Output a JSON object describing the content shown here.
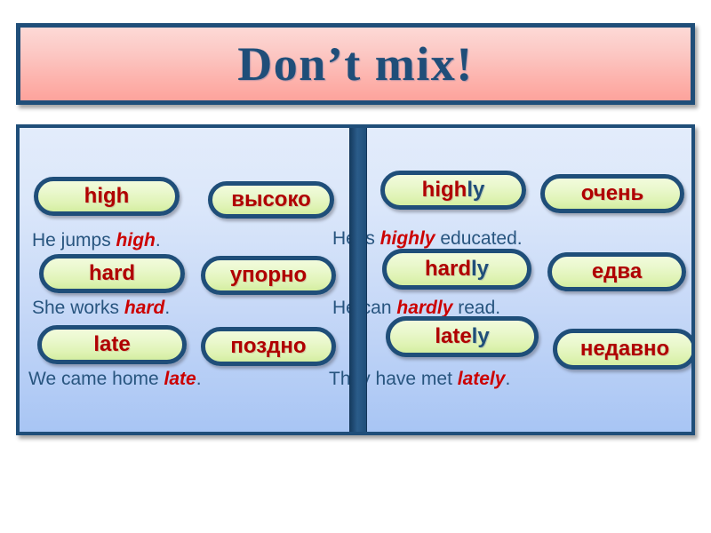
{
  "title": {
    "text": "Don’t mix!"
  },
  "colors": {
    "frame_navy": "#1f4e79",
    "title_bg_top": "#fdd9d6",
    "title_bg_bottom": "#fda39c",
    "panel_bg_top": "#e3ecfb",
    "panel_bg_bottom": "#a8c5f4",
    "pill_bg_top": "#f2fbdc",
    "pill_bg_bottom": "#d4eea1",
    "word_red": "#b00000",
    "suffix_navy": "#1f4e79",
    "sentence_navy": "#28557f",
    "keyword_red": "#cc0000"
  },
  "left_column": {
    "rows": [
      {
        "english_pill": {
          "root": "high",
          "suffix": ""
        },
        "russian_pill": "высоко",
        "sentence_before": "He  jumps  ",
        "sentence_keyword": "high",
        "sentence_after": "."
      },
      {
        "english_pill": {
          "root": "hard",
          "suffix": ""
        },
        "russian_pill": "упорно",
        "sentence_before": "She  works  ",
        "sentence_keyword": "hard",
        "sentence_after": "."
      },
      {
        "english_pill": {
          "root": "late",
          "suffix": ""
        },
        "russian_pill": "поздно",
        "sentence_before": "We came  home ",
        "sentence_keyword": "late",
        "sentence_after": "."
      }
    ]
  },
  "right_column": {
    "rows": [
      {
        "english_pill": {
          "root": "high",
          "suffix": "ly"
        },
        "russian_pill": "очень",
        "sentence_before": "He  is  ",
        "sentence_keyword": "highly",
        "sentence_after": "  educated."
      },
      {
        "english_pill": {
          "root": "hard",
          "suffix": "ly"
        },
        "russian_pill": "едва",
        "sentence_before": "He  can  ",
        "sentence_keyword": "hardly",
        "sentence_after": "  read."
      },
      {
        "english_pill": {
          "root": "late",
          "suffix": "ly"
        },
        "russian_pill": "недавно",
        "sentence_before": "They  have   met  ",
        "sentence_keyword": "lately",
        "sentence_after": "."
      }
    ]
  }
}
